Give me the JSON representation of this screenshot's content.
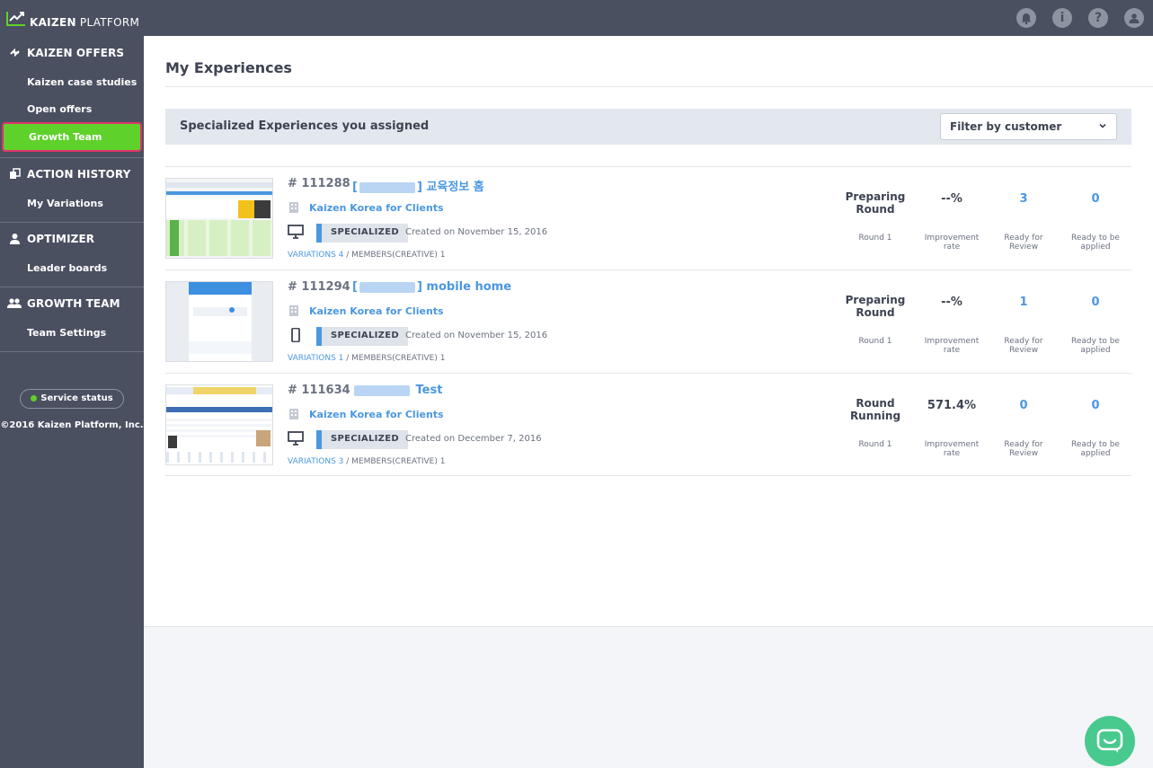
{
  "topbar": {
    "brand_bold": "KAIZEN",
    "brand_rest": "PLATFORM",
    "icons": [
      "bell-icon",
      "info-icon",
      "help-icon",
      "user-icon"
    ],
    "help_glyph": "?",
    "info_glyph": "i"
  },
  "sidebar": {
    "sections": [
      {
        "title": "KAIZEN OFFERS",
        "icon": "offers-icon",
        "items": [
          "Kaizen case studies",
          "Open offers",
          "Growth Team"
        ]
      },
      {
        "title": "ACTION HISTORY",
        "icon": "history-icon",
        "items": [
          "My Variations"
        ]
      },
      {
        "title": "OPTIMIZER",
        "icon": "person-icon",
        "items": [
          "Leader boards"
        ]
      },
      {
        "title": "GROWTH TEAM",
        "icon": "team-icon",
        "items": [
          "Team Settings"
        ]
      }
    ],
    "active_item": "Growth Team",
    "service_status": "Service status",
    "copyright": "©2016 Kaizen Platform, Inc."
  },
  "main": {
    "title": "My Experiences",
    "section_title": "Specialized Experiences you assigned",
    "filter_placeholder": "Filter by customer",
    "experiences": [
      {
        "id": "# 111288",
        "name_prefix": "[",
        "name_suffix": "] 교육정보 홈",
        "customer": "Kaizen Korea for Clients",
        "device": "desktop",
        "tag": "SPECIALIZED",
        "created": "Created on November 15, 2016",
        "variations_link": "VARIATIONS 4",
        "members": " / MEMBERS(CREATIVE) 1",
        "status_line1": "Preparing",
        "status_line2": "Round",
        "round": "Round 1",
        "improvement": "--%",
        "improvement_label1": "Improvement",
        "improvement_label2": "rate",
        "ready_review": "3",
        "ready_review_label1": "Ready for",
        "ready_review_label2": "Review",
        "ready_apply": "0",
        "ready_apply_label1": "Ready to be",
        "ready_apply_label2": "applied"
      },
      {
        "id": "# 111294",
        "name_prefix": "[",
        "name_suffix": "] mobile home",
        "customer": "Kaizen Korea for Clients",
        "device": "mobile",
        "tag": "SPECIALIZED",
        "created": "Created on November 15, 2016",
        "variations_link": "VARIATIONS 1",
        "members": " / MEMBERS(CREATIVE) 1",
        "status_line1": "Preparing",
        "status_line2": "Round",
        "round": "Round 1",
        "improvement": "--%",
        "improvement_label1": "Improvement",
        "improvement_label2": "rate",
        "ready_review": "1",
        "ready_review_label1": "Ready for",
        "ready_review_label2": "Review",
        "ready_apply": "0",
        "ready_apply_label1": "Ready to be",
        "ready_apply_label2": "applied"
      },
      {
        "id": "# 111634",
        "name_prefix": "",
        "name_suffix": " Test",
        "customer": "Kaizen Korea for Clients",
        "device": "desktop",
        "tag": "SPECIALIZED",
        "created": "Created on December 7, 2016",
        "variations_link": "VARIATIONS 3",
        "members": " / MEMBERS(CREATIVE) 1",
        "status_line1": "Round",
        "status_line2": "Running",
        "round": "Round 1",
        "improvement": "571.4%",
        "improvement_label1": "Improvement",
        "improvement_label2": "rate",
        "ready_review": "0",
        "ready_review_label1": "Ready for",
        "ready_review_label2": "Review",
        "ready_apply": "0",
        "ready_apply_label1": "Ready to be",
        "ready_apply_label2": "applied"
      }
    ]
  },
  "colors": {
    "sidebar": "#4a5060",
    "accent_green": "#5ed12a",
    "highlight_border": "#e0336b",
    "link_blue": "#4b97e0",
    "chat_green": "#48c98e"
  }
}
